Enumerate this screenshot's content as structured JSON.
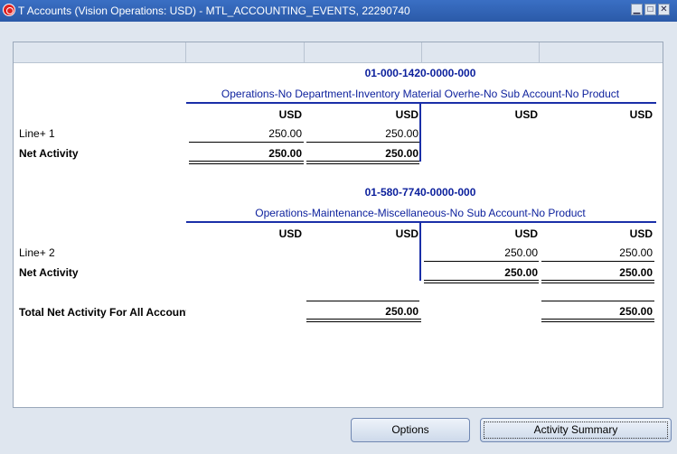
{
  "window": {
    "title": "T Accounts (Vision Operations: USD) - MTL_ACCOUNTING_EVENTS, 22290740",
    "minimize": "▁",
    "maximize": "□",
    "close": "✕"
  },
  "accounts": [
    {
      "code": "01-000-1420-0000-000",
      "description": "Operations-No Department-Inventory Material Overhe-No Sub Account-No Product",
      "currency_headers": [
        "USD",
        "USD",
        "USD",
        "USD"
      ],
      "line_label": "Line+ 1",
      "line_values": [
        "250.00",
        "250.00",
        "",
        ""
      ],
      "net_label": "Net Activity",
      "net_values": [
        "250.00",
        "250.00",
        "",
        ""
      ]
    },
    {
      "code": "01-580-7740-0000-000",
      "description": "Operations-Maintenance-Miscellaneous-No Sub Account-No Product",
      "currency_headers": [
        "USD",
        "USD",
        "USD",
        "USD"
      ],
      "line_label": "Line+ 2",
      "line_values": [
        "",
        "",
        "250.00",
        "250.00"
      ],
      "net_label": "Net Activity",
      "net_values": [
        "",
        "",
        "250.00",
        "250.00"
      ]
    }
  ],
  "total": {
    "label": "Total Net Activity For All Accounts",
    "debit": "250.00",
    "credit": "250.00"
  },
  "buttons": {
    "options": "Options",
    "activity_summary": "Activity Summary"
  }
}
